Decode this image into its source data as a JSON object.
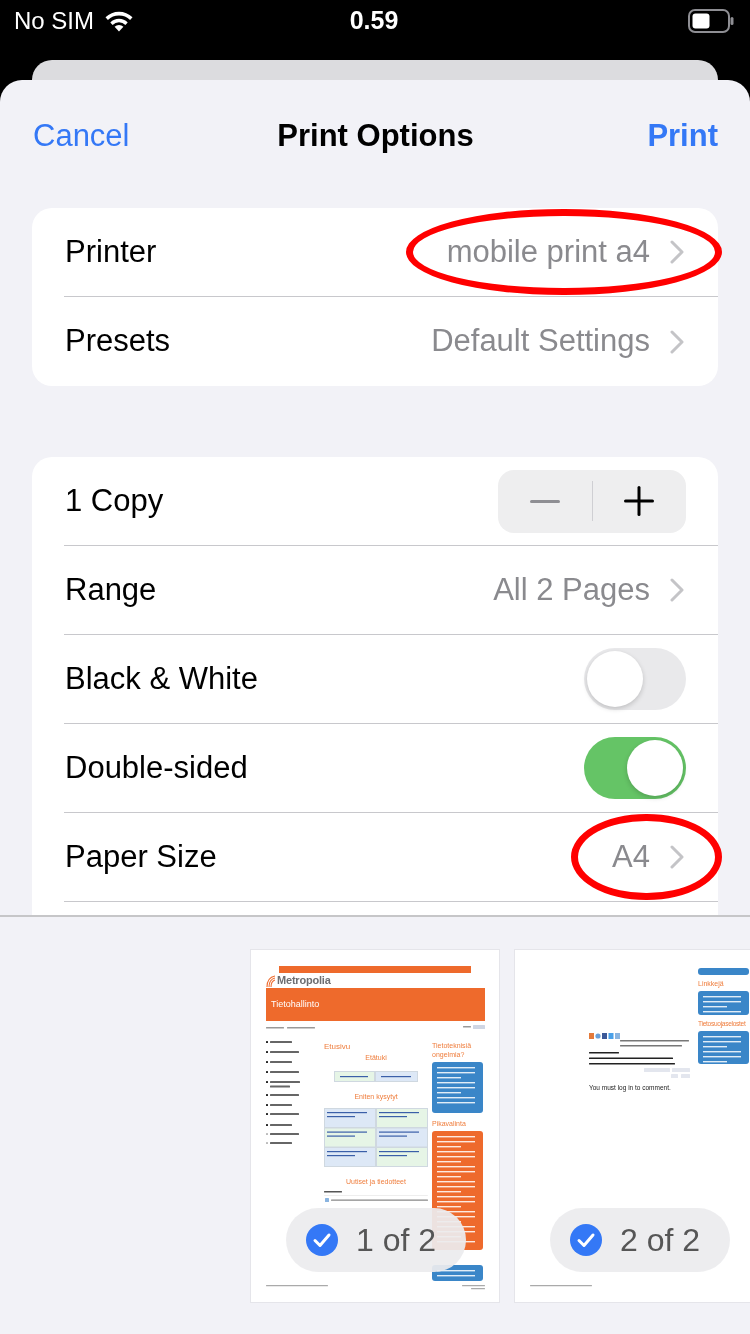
{
  "status_bar": {
    "carrier": "No SIM",
    "time": "0.59"
  },
  "header": {
    "cancel": "Cancel",
    "title": "Print Options",
    "confirm": "Print"
  },
  "groups": [
    {
      "rows": [
        {
          "kind": "link",
          "label": "Printer",
          "value": "mobile print a4",
          "circled": true
        },
        {
          "kind": "link",
          "label": "Presets",
          "value": "Default Settings",
          "circled": false
        }
      ]
    },
    {
      "rows": [
        {
          "kind": "stepper",
          "label": "1 Copy",
          "decrement_disabled": true
        },
        {
          "kind": "link",
          "label": "Range",
          "value": "All 2 Pages",
          "circled": false
        },
        {
          "kind": "toggle",
          "label": "Black & White",
          "on": false
        },
        {
          "kind": "toggle",
          "label": "Double-sided",
          "on": true
        },
        {
          "kind": "link",
          "label": "Paper Size",
          "value": "A4",
          "circled": true
        }
      ]
    }
  ],
  "pages": [
    {
      "kind": "home",
      "badge": "1 of 2",
      "selected": true,
      "logo": "Metropolia",
      "banner": "Tietohallinto",
      "headings": [
        "Etusivu",
        "Etätuki",
        "Eniten kysytyt",
        "Uutiset ja tiedotteet"
      ],
      "side_headings": [
        "Tietoteknisiä ongelmia?",
        "Pikavalinta"
      ]
    },
    {
      "kind": "comments",
      "badge": "2 of 2",
      "selected": true,
      "comment_prompt": "You must log in to comment.",
      "side_headings": [
        "Linkkejä",
        "Tietosuojaselostet"
      ]
    }
  ]
}
